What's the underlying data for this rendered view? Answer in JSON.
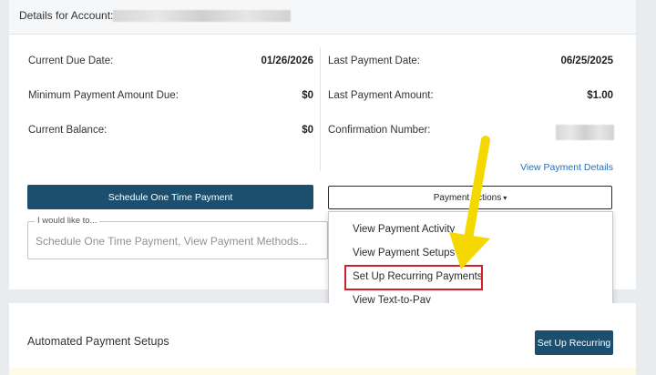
{
  "header": {
    "account_label": "Details for Account:"
  },
  "left_rows": [
    {
      "label": "Current Due Date:",
      "value": "01/26/2026"
    },
    {
      "label": "Minimum Payment Amount Due:",
      "value": "$0"
    },
    {
      "label": "Current Balance:",
      "value": "$0"
    }
  ],
  "right_rows": [
    {
      "label": "Last Payment Date:",
      "value": "06/25/2025"
    },
    {
      "label": "Last Payment Amount:",
      "value": "$1.00"
    },
    {
      "label": "Confirmation Number:",
      "value": ""
    }
  ],
  "links": {
    "view_payment_details": "View Payment Details"
  },
  "buttons": {
    "schedule_one_time": "Schedule One Time Payment",
    "payment_actions": "Payment Actions",
    "set_up_recurring": "Set Up Recurring"
  },
  "i_would_like": {
    "legend": "I would like to...",
    "placeholder": "Schedule One Time Payment, View Payment Methods..."
  },
  "dropdown_menu": {
    "items": [
      "View Payment Activity",
      "View Payment Setups",
      "Set Up Recurring Payments",
      "View Text-to-Pay"
    ],
    "highlighted_index": 2
  },
  "automated_section": {
    "title": "Automated Payment Setups"
  },
  "colors": {
    "primary_button": "#1c4f6e",
    "link": "#2a6db1",
    "highlight_border": "#d0202f",
    "arrow": "#f5d800"
  }
}
